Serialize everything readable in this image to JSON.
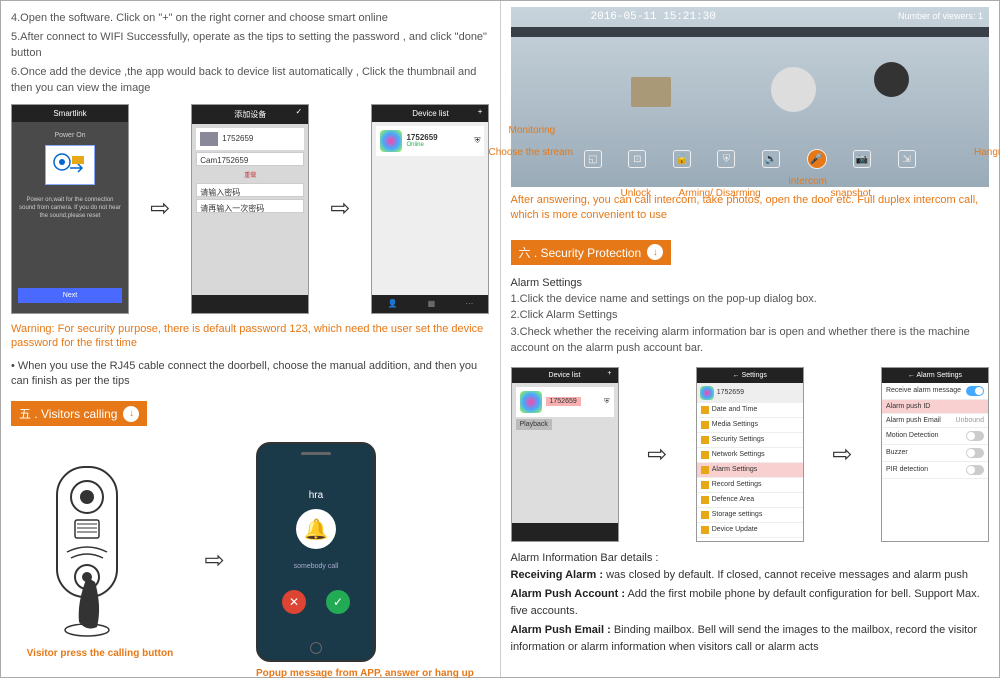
{
  "left": {
    "step4": "4.Open the software. Click on \"+\" on the right corner and choose smart online",
    "step5": "5.After connect to WIFI Successfully, operate as the tips to setting the password , and click \"done\" button",
    "step6": "6.Once add the device ,the app would back to device list automatically , Click the thumbnail and then you can view the image",
    "screens": {
      "smartlink_title": "Smartlink",
      "power_on": "Power On",
      "power_hint": "Power on,wait for the connection sound from camera. If you do not hear the sound,please reset",
      "next": "Next",
      "add_device_title": "添加设备",
      "device_id": "1752659",
      "cam_name": "Cam1752659",
      "redo": "重做",
      "input1": "请输入密码",
      "input2": "请再输入一次密码",
      "devlist_title": "Device list",
      "devlist_id": "1752659",
      "online": "Online"
    },
    "warning": "Warning: For security purpose, there is default password 123, which need the user set the device password for the first time",
    "bullet": "• When you use the RJ45 cable connect the doorbell, choose the manual addition, and then you can finish as per the tips",
    "section5": "五 . Visitors calling",
    "caller_name": "hra",
    "caption_left": "Visitor press the calling button",
    "caption_right": "Popup message from APP, answer or hang up"
  },
  "right": {
    "cam_ts": "2016-05-11 15:21:30",
    "viewers": "Number of viewers: 1",
    "labels": {
      "monitoring": "Monitoring",
      "choose_stream": "Choose the stream",
      "unlock": "Unlock",
      "arming": "Arming/ Disarming",
      "intercom": "intercom",
      "snapshot": "snapshot",
      "hangup": "Hangup"
    },
    "orange_note": "After answering, you can call intercom, take photos, open the door etc. Full duplex intercom call, which is more convenient to use",
    "section6": "六 . Security Protection",
    "alarm_h": "Alarm Settings",
    "alarm1": "1.Click the device name and settings on the pop-up dialog box.",
    "alarm2": "2.Click Alarm Settings",
    "alarm3": "3.Check whether the receiving alarm information bar is open and whether there is the machine account on the alarm push account bar.",
    "screens": {
      "devlist": "Device list",
      "dev_id": "1752659",
      "playback": "Playback",
      "settings_title": "Settings",
      "date_time": "Date and Time",
      "media": "Media Settings",
      "security": "Security Settings",
      "network": "Network Settings",
      "alarm_settings": "Alarm Settings",
      "record": "Record Settings",
      "defence": "Defence Area",
      "storage": "Storage settings",
      "update": "Device Update",
      "alarm_hdr": "Alarm Settings",
      "receive_msg": "Receive alarm message",
      "alarm_push_id": "Alarm push ID",
      "alarm_push_email": "Alarm push Email",
      "motion": "Motion Detection",
      "buzzer": "Buzzer",
      "pir": "PIR detection",
      "unbound": "Unbound"
    },
    "detail_h": "Alarm Information Bar details :",
    "d1_b": "Receiving Alarm :",
    "d1": " was closed by default. If closed, cannot receive messages and alarm push",
    "d2_b": "Alarm Push Account :",
    "d2": " Add the first mobile phone by default configuration for bell. Support Max. five accounts.",
    "d3_b": "Alarm Push Email :",
    "d3": " Binding mailbox. Bell will send the images to the mailbox, record the visitor information or alarm information when visitors call or alarm acts"
  }
}
